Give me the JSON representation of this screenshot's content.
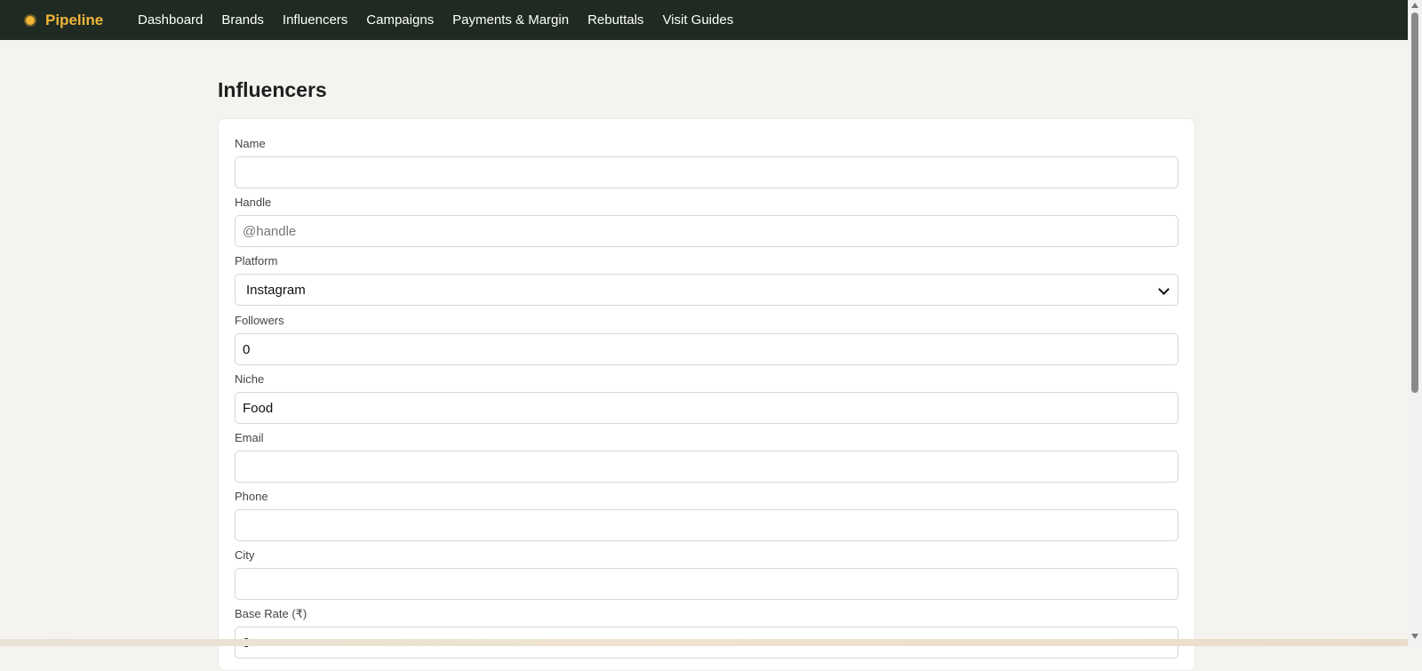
{
  "app": {
    "name": "Pipeline"
  },
  "nav": {
    "items": [
      {
        "label": "Dashboard"
      },
      {
        "label": "Brands"
      },
      {
        "label": "Influencers"
      },
      {
        "label": "Campaigns"
      },
      {
        "label": "Payments & Margin"
      },
      {
        "label": "Rebuttals"
      },
      {
        "label": "Visit Guides"
      }
    ]
  },
  "page": {
    "title": "Influencers"
  },
  "form": {
    "name": {
      "label": "Name",
      "value": "",
      "placeholder": ""
    },
    "handle": {
      "label": "Handle",
      "value": "",
      "placeholder": "@handle"
    },
    "platform": {
      "label": "Platform",
      "selected": "Instagram"
    },
    "followers": {
      "label": "Followers",
      "value": "0"
    },
    "niche": {
      "label": "Niche",
      "value": "Food"
    },
    "email": {
      "label": "Email",
      "value": ""
    },
    "phone": {
      "label": "Phone",
      "value": ""
    },
    "city": {
      "label": "City",
      "value": ""
    },
    "base_rate": {
      "label": "Base Rate (₹)",
      "value": "0"
    }
  },
  "icons": {
    "brand": "logo-dot-icon",
    "select": "chevron-down-icon"
  },
  "colors": {
    "topbar": "#1f2b22",
    "brand": "#f0b43a",
    "background": "#f4f3ef"
  }
}
